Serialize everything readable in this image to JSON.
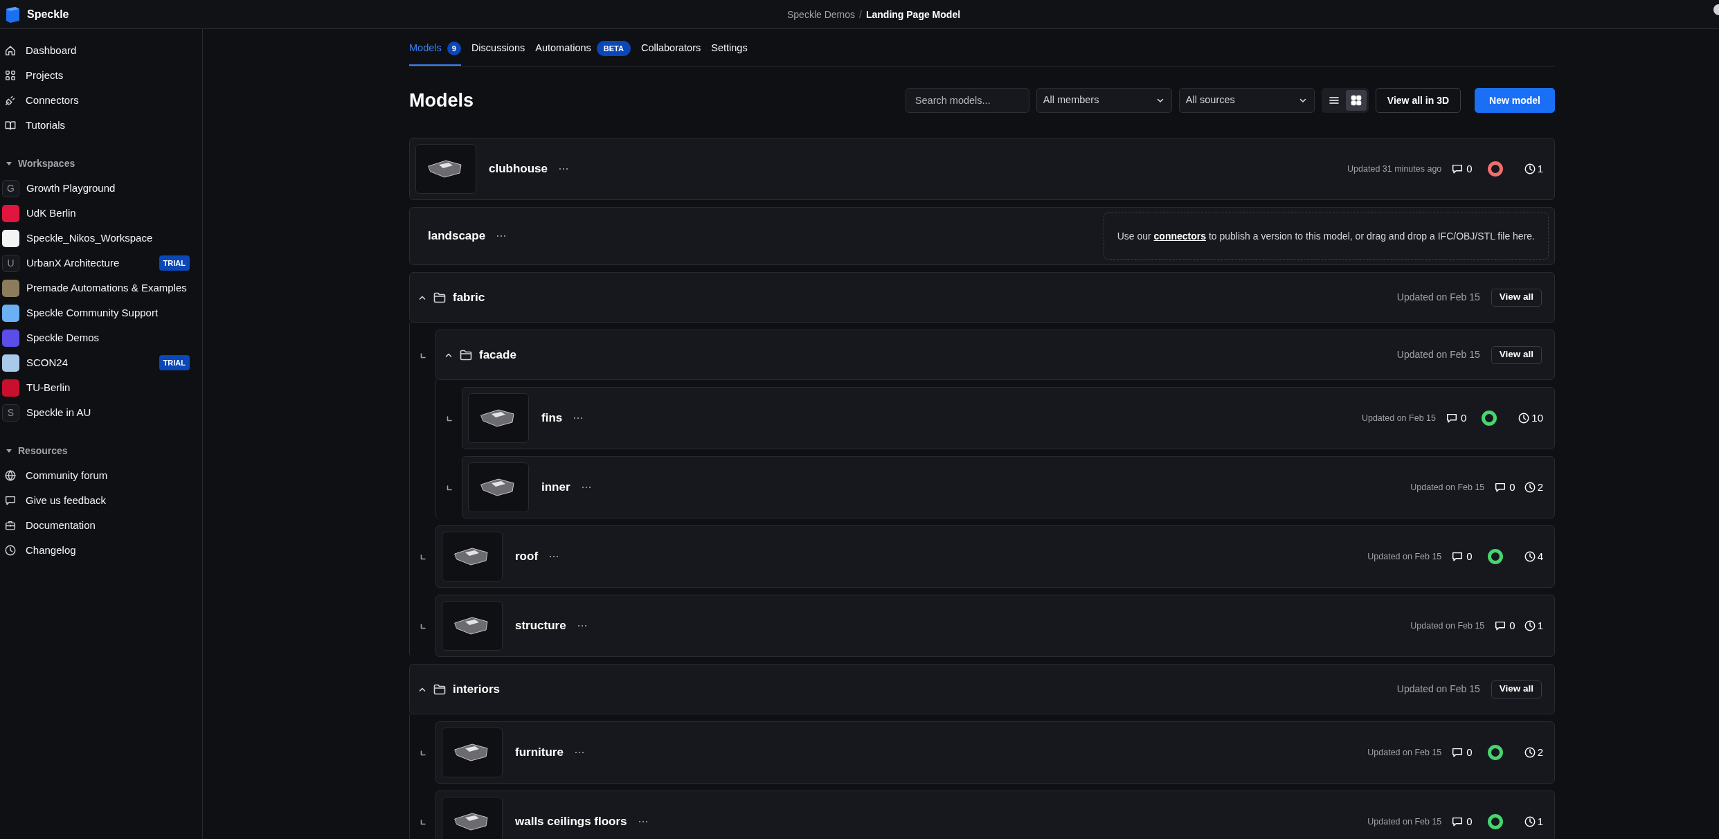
{
  "header": {
    "brand": "Speckle",
    "separator": "/",
    "breadcrumb": [
      {
        "label": "Speckle Demos",
        "current": false
      },
      {
        "label": "Landing Page Model",
        "current": true
      }
    ]
  },
  "sidebar": {
    "nav": [
      {
        "label": "Dashboard"
      },
      {
        "label": "Projects"
      },
      {
        "label": "Connectors"
      },
      {
        "label": "Tutorials"
      }
    ],
    "workspaces": {
      "title": "Workspaces",
      "expanded": true,
      "items": [
        {
          "label": "Growth Playground",
          "avatar_letter": "G"
        },
        {
          "label": "UdK Berlin",
          "color": "#e0163f"
        },
        {
          "label": "Speckle_Nikos_Workspace",
          "color": "#f4f4f5"
        },
        {
          "label": "UrbanX Architecture",
          "avatar_letter": "U",
          "badge": "TRIAL"
        },
        {
          "label": "Premade Automations & Examples",
          "color": "#8b7d5c"
        },
        {
          "label": "Speckle Community Support",
          "color": "#6ab0f3"
        },
        {
          "label": "Speckle Demos",
          "color": "#5b4de8"
        },
        {
          "label": "SCON24",
          "color": "#a9c9ea",
          "badge": "TRIAL"
        },
        {
          "label": "TU-Berlin",
          "color": "#c8102e"
        },
        {
          "label": "Speckle in AU",
          "avatar_letter": "S"
        }
      ]
    },
    "resources": {
      "title": "Resources",
      "expanded": true,
      "items": [
        {
          "label": "Community forum"
        },
        {
          "label": "Give us feedback"
        },
        {
          "label": "Documentation"
        },
        {
          "label": "Changelog"
        }
      ]
    }
  },
  "tabs": [
    {
      "label": "Models",
      "count": "9",
      "selected": true
    },
    {
      "label": "Discussions",
      "selected": false
    },
    {
      "label": "Automations",
      "badge": "BETA",
      "selected": false
    },
    {
      "label": "Collaborators",
      "selected": false
    },
    {
      "label": "Settings",
      "selected": false
    }
  ],
  "toolbar": {
    "title": "Models",
    "search": {
      "placeholder": "Search models..."
    },
    "filters": [
      "All members",
      "All sources"
    ],
    "view_modes": [
      {
        "kind": "list",
        "selected": false
      },
      {
        "kind": "grid",
        "selected": true
      }
    ],
    "buttons": [
      {
        "label": "View all in 3D",
        "kind": "secondary"
      },
      {
        "label": "New model",
        "kind": "primary"
      }
    ]
  },
  "models": [
    {
      "kind": "model",
      "name": "clubhouse",
      "updated": "Updated 31 minutes ago",
      "comments": "0",
      "color": "#f26d6d",
      "versions": "1"
    },
    {
      "kind": "empty_model",
      "name": "landscape",
      "hint_before": "Use our ",
      "link": "connectors",
      "hint_after": " to publish a version to this model, or drag and drop a IFC/OBJ/STL file here."
    },
    {
      "kind": "group",
      "name": "fabric",
      "expanded": true,
      "updated": "Updated on Feb 15",
      "action": "View all",
      "children": [
        {
          "kind": "group",
          "name": "facade",
          "expanded": true,
          "updated": "Updated on Feb 15",
          "action": "View all",
          "children": [
            {
              "kind": "model",
              "name": "fins",
              "updated": "Updated on Feb 15",
              "comments": "0",
              "color": "#46d66f",
              "versions": "10"
            },
            {
              "kind": "model",
              "name": "inner",
              "updated": "Updated on Feb 15",
              "comments": "0",
              "versions": "2"
            }
          ]
        },
        {
          "kind": "model",
          "name": "roof",
          "updated": "Updated on Feb 15",
          "comments": "0",
          "color": "#46d66f",
          "versions": "4"
        },
        {
          "kind": "model",
          "name": "structure",
          "updated": "Updated on Feb 15",
          "comments": "0",
          "versions": "1"
        }
      ]
    },
    {
      "kind": "group",
      "name": "interiors",
      "expanded": true,
      "updated": "Updated on Feb 15",
      "action": "View all",
      "children": [
        {
          "kind": "model",
          "name": "furniture",
          "updated": "Updated on Feb 15",
          "comments": "0",
          "color": "#46d66f",
          "versions": "2"
        },
        {
          "kind": "model",
          "name": "walls ceilings floors",
          "updated": "Updated on Feb 15",
          "comments": "0",
          "color": "#46d66f",
          "versions": "1"
        }
      ]
    }
  ]
}
